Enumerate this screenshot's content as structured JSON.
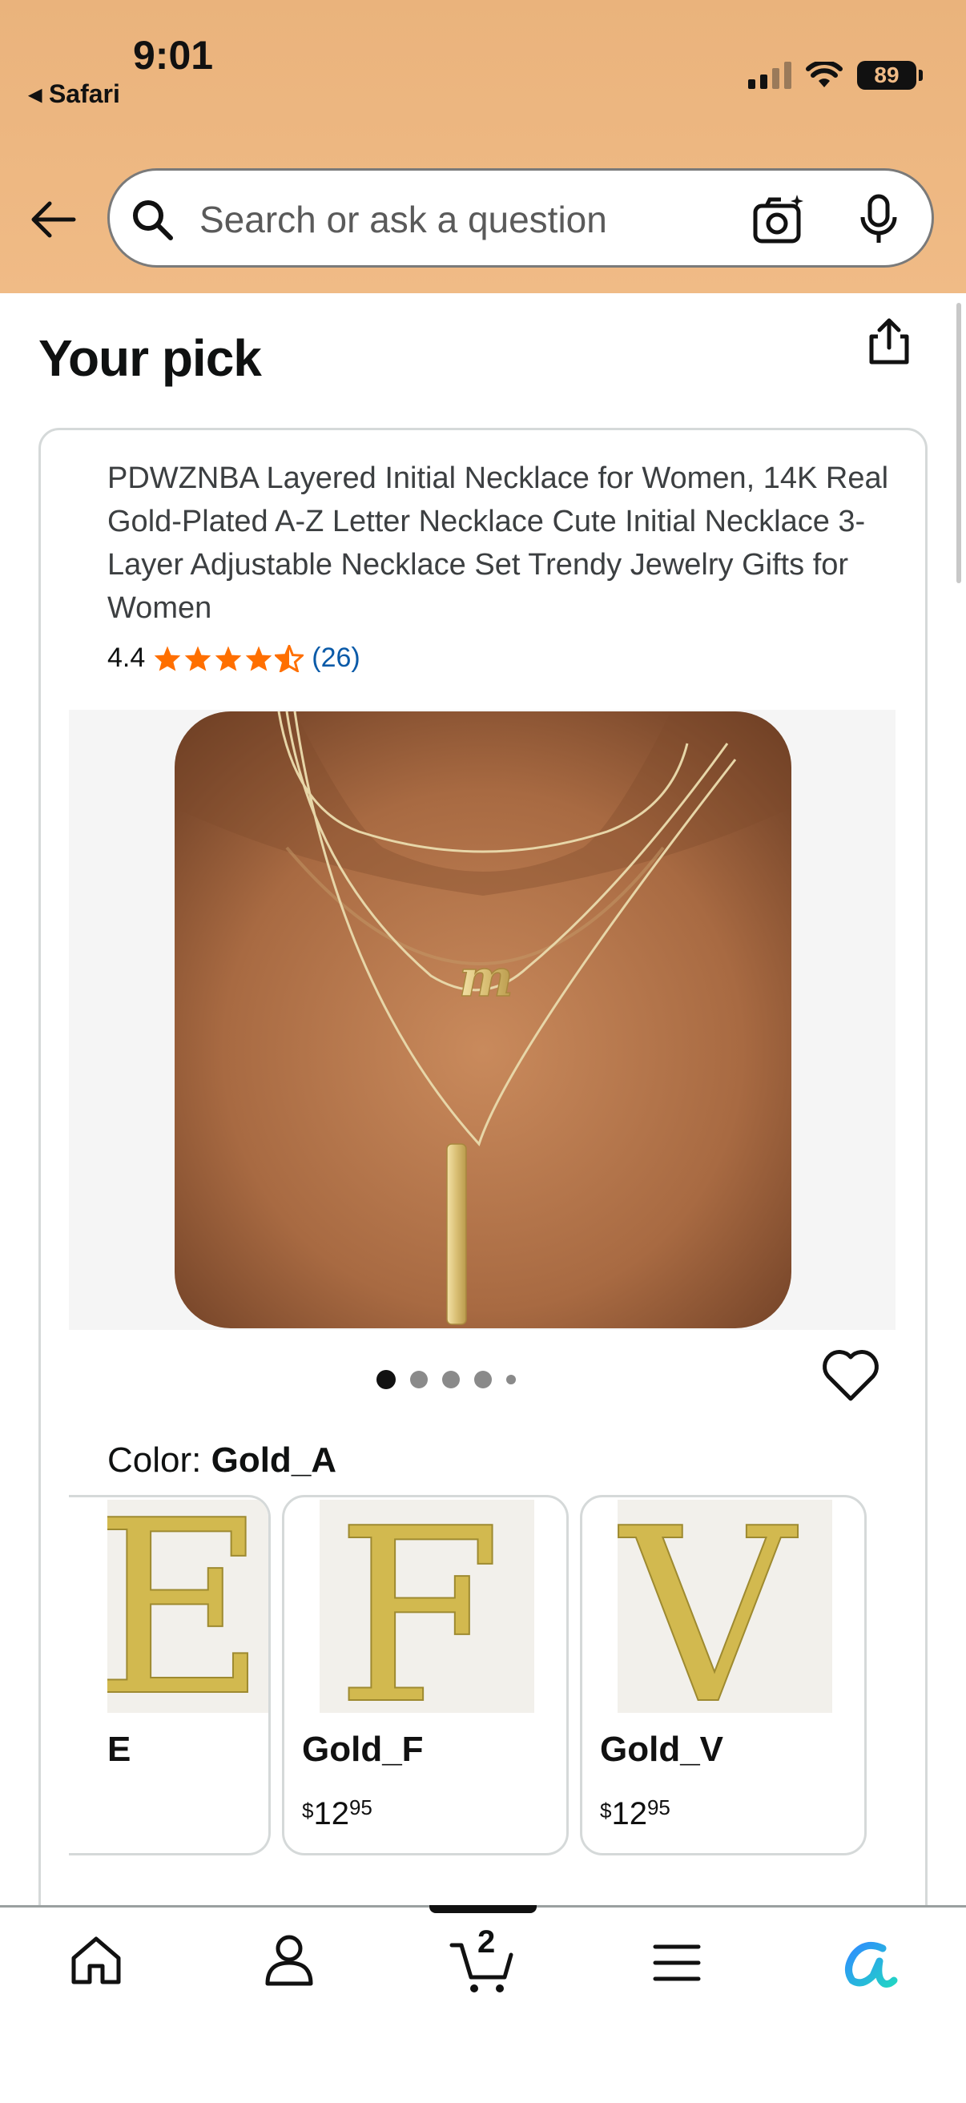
{
  "status_bar": {
    "time": "9:01",
    "back_app": "Safari",
    "battery": "89"
  },
  "search": {
    "placeholder": "Search or ask a question"
  },
  "section": {
    "title": "Your pick"
  },
  "product": {
    "title": "PDWZNBA Layered Initial Necklace for Women, 14K Real Gold-Plated A-Z Letter Necklace Cute Initial Necklace 3-Layer Adjustable Necklace Set Trendy Jewelry Gifts for Women",
    "rating": "4.4",
    "stars": 4.4,
    "review_count": "(26)",
    "image_count": 5,
    "active_image": 1
  },
  "color": {
    "label": "Color:",
    "selected": "Gold_A",
    "options": [
      {
        "name": "E",
        "letter": "E",
        "price_currency": "",
        "price_whole": "",
        "price_fraction": ""
      },
      {
        "name": "Gold_F",
        "letter": "F",
        "price_currency": "$",
        "price_whole": "12",
        "price_fraction": "95"
      },
      {
        "name": "Gold_V",
        "letter": "V",
        "price_currency": "$",
        "price_whole": "12",
        "price_fraction": "95"
      }
    ]
  },
  "tabbar": {
    "cart_count": "2",
    "items": [
      "home-icon",
      "account-icon",
      "cart-icon",
      "menu-icon",
      "rufus-icon"
    ]
  },
  "colors": {
    "header_bg": "#f0bb86",
    "star": "#ff6f00",
    "link": "#0a5aa8"
  }
}
